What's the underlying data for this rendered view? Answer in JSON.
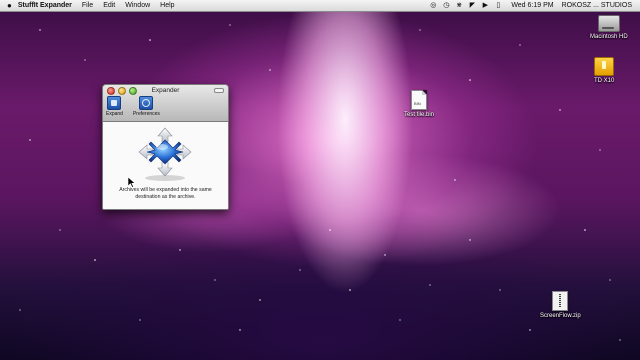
{
  "menubar": {
    "app_name": "StuffIt Expander",
    "items": [
      "File",
      "Edit",
      "Window",
      "Help"
    ],
    "clock": "Wed 6:19 PM",
    "user": "ROKOSZ  ...  STUDIOS",
    "status_icons": [
      "time-machine-icon",
      "history-icon",
      "bluetooth-icon",
      "wifi-icon",
      "volume-icon",
      "battery-icon"
    ]
  },
  "desktop": {
    "icons": [
      {
        "label": "Macintosh HD",
        "type": "hard-drive"
      },
      {
        "label": "TD X10",
        "type": "external-drive"
      },
      {
        "label": "Test file.bin",
        "type": "document"
      },
      {
        "label": "ScreenFlow.zip",
        "type": "zip-archive"
      }
    ]
  },
  "window": {
    "title": "Expander",
    "toolbar": {
      "expand_label": "Expand",
      "preferences_label": "Preferences"
    },
    "info_text": "Archives will be expanded into the same destination as the archive."
  },
  "colors": {
    "accent_blue": "#2a6fd6",
    "menubar_bg": "#e6e6e6",
    "wallpaper_pink": "#e86fd0"
  }
}
